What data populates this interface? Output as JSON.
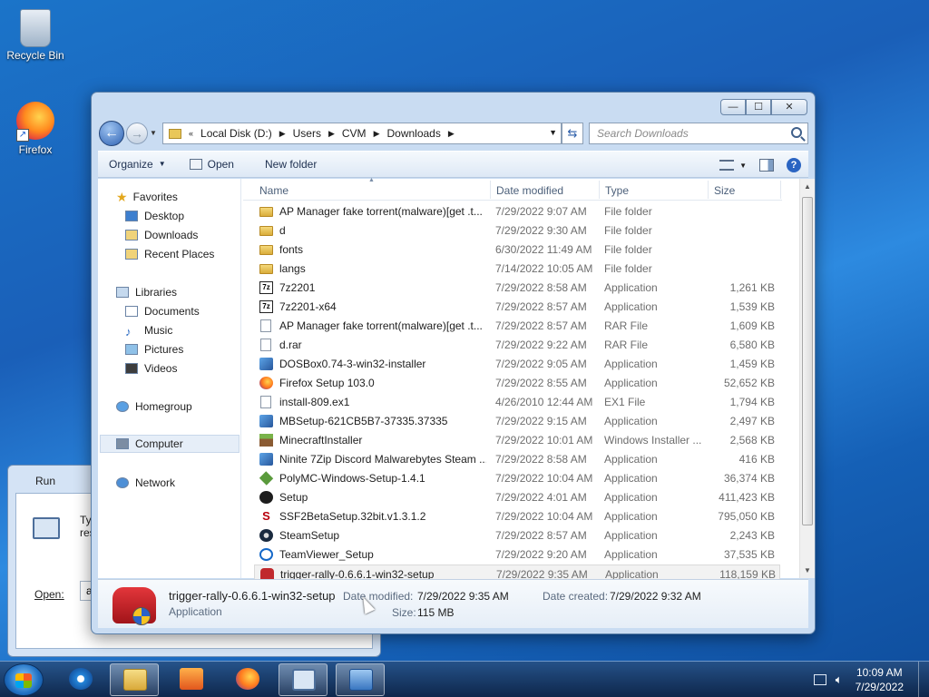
{
  "desktop": {
    "icons": [
      {
        "label": "Recycle Bin"
      },
      {
        "label": "Firefox"
      }
    ]
  },
  "run_dialog": {
    "title": "Run",
    "description_line1": "Typ",
    "description_line2": "reso",
    "open_label": "Open:",
    "open_value": "agl"
  },
  "explorer": {
    "caption_buttons": {
      "minimize": "—",
      "maximize": "☐",
      "close": "✕"
    },
    "address": {
      "crumbs": [
        "Local Disk (D:)",
        "Users",
        "CVM",
        "Downloads"
      ]
    },
    "search_placeholder": "Search Downloads",
    "toolbar": {
      "organize": "Organize",
      "open": "Open",
      "new_folder": "New folder"
    },
    "nav": {
      "favorites": "Favorites",
      "desktop": "Desktop",
      "downloads": "Downloads",
      "recent_places": "Recent Places",
      "libraries": "Libraries",
      "documents": "Documents",
      "music": "Music",
      "pictures": "Pictures",
      "videos": "Videos",
      "homegroup": "Homegroup",
      "computer": "Computer",
      "network": "Network"
    },
    "columns": {
      "name": "Name",
      "date": "Date modified",
      "type": "Type",
      "size": "Size"
    },
    "files": [
      {
        "icon": "folder",
        "name": "AP Manager fake torrent(malware)[get .t...",
        "date": "7/29/2022 9:07 AM",
        "type": "File folder",
        "size": ""
      },
      {
        "icon": "folder",
        "name": "d",
        "date": "7/29/2022 9:30 AM",
        "type": "File folder",
        "size": ""
      },
      {
        "icon": "folder",
        "name": "fonts",
        "date": "6/30/2022 11:49 AM",
        "type": "File folder",
        "size": ""
      },
      {
        "icon": "folder",
        "name": "langs",
        "date": "7/14/2022 10:05 AM",
        "type": "File folder",
        "size": ""
      },
      {
        "icon": "7z",
        "name": "7z2201",
        "date": "7/29/2022 8:58 AM",
        "type": "Application",
        "size": "1,261 KB"
      },
      {
        "icon": "7z",
        "name": "7z2201-x64",
        "date": "7/29/2022 8:57 AM",
        "type": "Application",
        "size": "1,539 KB"
      },
      {
        "icon": "file",
        "name": "AP Manager fake torrent(malware)[get .t...",
        "date": "7/29/2022 8:57 AM",
        "type": "RAR File",
        "size": "1,609 KB"
      },
      {
        "icon": "file",
        "name": "d.rar",
        "date": "7/29/2022 9:22 AM",
        "type": "RAR File",
        "size": "6,580 KB"
      },
      {
        "icon": "app",
        "name": "DOSBox0.74-3-win32-installer",
        "date": "7/29/2022 9:05 AM",
        "type": "Application",
        "size": "1,459 KB"
      },
      {
        "icon": "ff",
        "name": "Firefox Setup 103.0",
        "date": "7/29/2022 8:55 AM",
        "type": "Application",
        "size": "52,652 KB"
      },
      {
        "icon": "file",
        "name": "install-809.ex1",
        "date": "4/26/2010 12:44 AM",
        "type": "EX1 File",
        "size": "1,794 KB"
      },
      {
        "icon": "app",
        "name": "MBSetup-621CB5B7-37335.37335",
        "date": "7/29/2022 9:15 AM",
        "type": "Application",
        "size": "2,497 KB"
      },
      {
        "icon": "mc",
        "name": "MinecraftInstaller",
        "date": "7/29/2022 10:01 AM",
        "type": "Windows Installer ...",
        "size": "2,568 KB"
      },
      {
        "icon": "app",
        "name": "Ninite 7Zip Discord Malwarebytes Steam ...",
        "date": "7/29/2022 8:58 AM",
        "type": "Application",
        "size": "416 KB"
      },
      {
        "icon": "green",
        "name": "PolyMC-Windows-Setup-1.4.1",
        "date": "7/29/2022 10:04 AM",
        "type": "Application",
        "size": "36,374 KB"
      },
      {
        "icon": "setup",
        "name": "Setup",
        "date": "7/29/2022 4:01 AM",
        "type": "Application",
        "size": "411,423 KB"
      },
      {
        "icon": "ssf",
        "name": "SSF2BetaSetup.32bit.v1.3.1.2",
        "date": "7/29/2022 10:04 AM",
        "type": "Application",
        "size": "795,050 KB"
      },
      {
        "icon": "steam",
        "name": "SteamSetup",
        "date": "7/29/2022 8:57 AM",
        "type": "Application",
        "size": "2,243 KB"
      },
      {
        "icon": "tv",
        "name": "TeamViewer_Setup",
        "date": "7/29/2022 9:20 AM",
        "type": "Application",
        "size": "37,535 KB"
      },
      {
        "icon": "car",
        "name": "trigger-rally-0.6.6.1-win32-setup",
        "date": "7/29/2022 9:35 AM",
        "type": "Application",
        "size": "118,159 KB"
      }
    ],
    "details": {
      "name": "trigger-rally-0.6.6.1-win32-setup",
      "type": "Application",
      "date_modified_label": "Date modified:",
      "date_modified": "7/29/2022 9:35 AM",
      "date_created_label": "Date created:",
      "date_created": "7/29/2022 9:32 AM",
      "size_label": "Size:",
      "size": "115 MB"
    }
  },
  "taskbar": {
    "time": "10:09 AM",
    "date": "7/29/2022"
  }
}
